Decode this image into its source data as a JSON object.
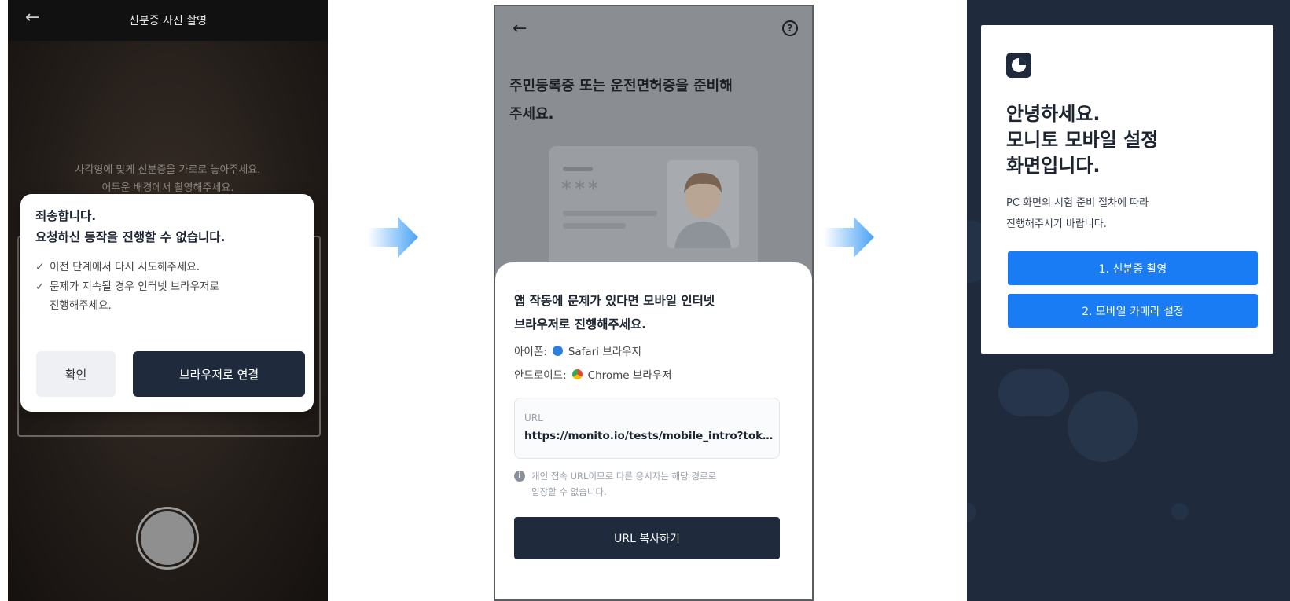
{
  "colors": {
    "navy": "#1f2b3d",
    "accent_blue": "#1a7cf5",
    "arrow_blue": "#4aa3f5"
  },
  "panel1": {
    "back_icon": "arrow-left-icon",
    "title": "신분증 사진 촬영",
    "guide_line1": "사각형에 맞게 신분증을 가로로 놓아주세요.",
    "guide_line2": "어두운 배경에서 촬영해주세요.",
    "dialog": {
      "title_line1": "죄송합니다.",
      "title_line2": "요청하신 동작을 진행할 수 없습니다.",
      "item1": "이전 단계에서 다시 시도해주세요.",
      "item2_line1": "문제가 지속될 경우 인터넷 브라우저로",
      "item2_line2": "진행해주세요.",
      "confirm_label": "확인",
      "open_browser_label": "브라우저로 연결"
    }
  },
  "panel2": {
    "back_icon": "arrow-left-icon",
    "help_icon": "question-circle-icon",
    "help_glyph": "?",
    "title_line1": "주민등록증 또는 운전면허증을 준비해",
    "title_line2": "주세요.",
    "card_stars": "***",
    "sheet": {
      "title_line1": "앱 작동에 문제가 있다면 모바일 인터넷",
      "title_line2": "브라우저로 진행해주세요.",
      "iphone_label": "아이폰:",
      "iphone_browser": "Safari 브라우저",
      "android_label": "안드로이드:",
      "android_browser": "Chrome 브라우저",
      "url_label": "URL",
      "url_value": "https://monito.io/tests/mobile_intro?toke...",
      "notice_line1": "개인 접속 URL이므로 다른 응시자는 해당 경로로",
      "notice_line2": "입장할 수 없습니다.",
      "copy_label": "URL 복사하기"
    }
  },
  "panel3": {
    "logo_icon": "monito-logo-icon",
    "heading_line1": "안녕하세요.",
    "heading_line2": "모니토 모바일 설정",
    "heading_line3": "화면입니다.",
    "desc_line1": "PC 화면의 시험 준비 절차에 따라",
    "desc_line2": "진행해주시기 바랍니다.",
    "button1": "1. 신분증 촬영",
    "button2": "2. 모바일 카메라 설정"
  }
}
